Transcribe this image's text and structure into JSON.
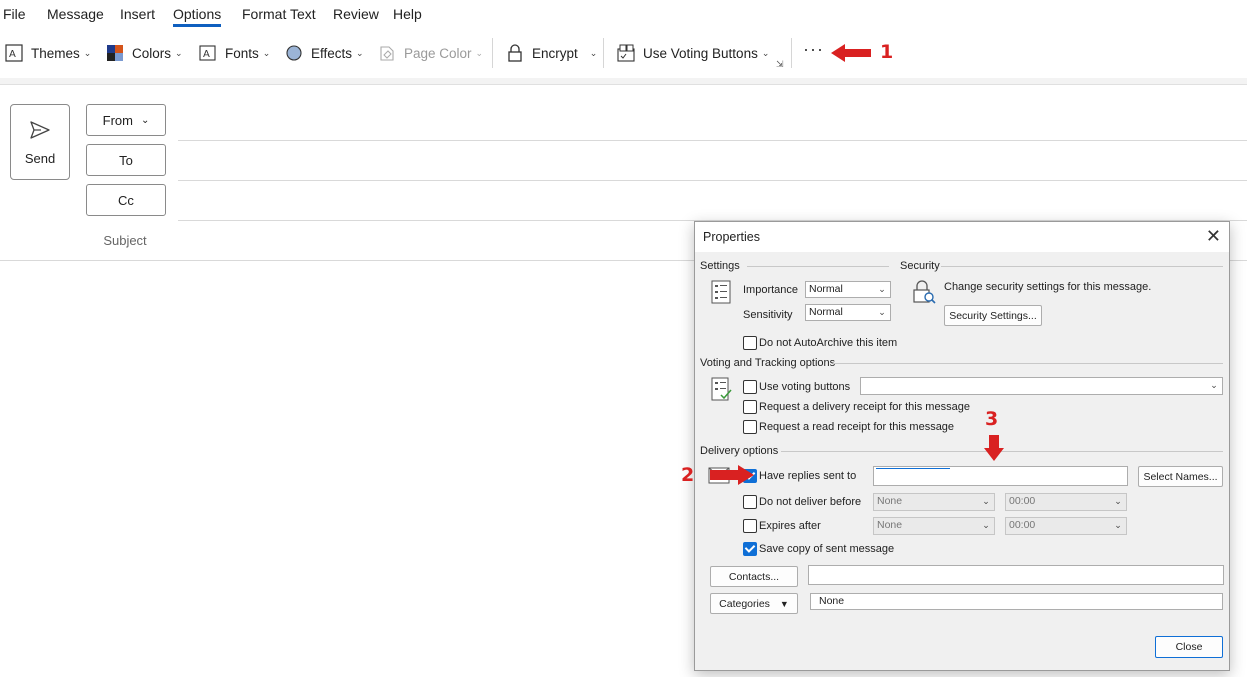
{
  "menu": {
    "items": [
      "File",
      "Message",
      "Insert",
      "Options",
      "Format Text",
      "Review",
      "Help"
    ],
    "active": "Options"
  },
  "ribbon": {
    "themes": "Themes",
    "colors": "Colors",
    "fonts": "Fonts",
    "effects": "Effects",
    "page_color": "Page Color",
    "encrypt": "Encrypt",
    "voting": "Use Voting Buttons",
    "more": "···"
  },
  "compose": {
    "send": "Send",
    "from": "From",
    "to": "To",
    "cc": "Cc",
    "subject": "Subject"
  },
  "dialog": {
    "title": "Properties",
    "settings": {
      "heading": "Settings",
      "importance_label": "Importance",
      "importance_value": "Normal",
      "sensitivity_label": "Sensitivity",
      "sensitivity_value": "Normal",
      "autoarchive": "Do not AutoArchive this item"
    },
    "security": {
      "heading": "Security",
      "text": "Change security settings for this message.",
      "button": "Security Settings..."
    },
    "voting": {
      "heading": "Voting and Tracking options",
      "use_voting": "Use voting buttons",
      "delivery_receipt": "Request a delivery receipt for this message",
      "read_receipt": "Request a read receipt for this message"
    },
    "delivery": {
      "heading": "Delivery options",
      "replies": "Have replies sent to",
      "select_names": "Select Names...",
      "not_before": "Do not deliver before",
      "expires": "Expires after",
      "date_none": "None",
      "time_zero": "00:00",
      "save_copy": "Save copy of sent message"
    },
    "contacts": "Contacts...",
    "categories": "Categories",
    "categories_value": "None",
    "close": "Close"
  },
  "annotations": [
    "1",
    "2",
    "3"
  ],
  "colors": {
    "accent": "#0f6fd6",
    "annotation": "#d92121"
  }
}
